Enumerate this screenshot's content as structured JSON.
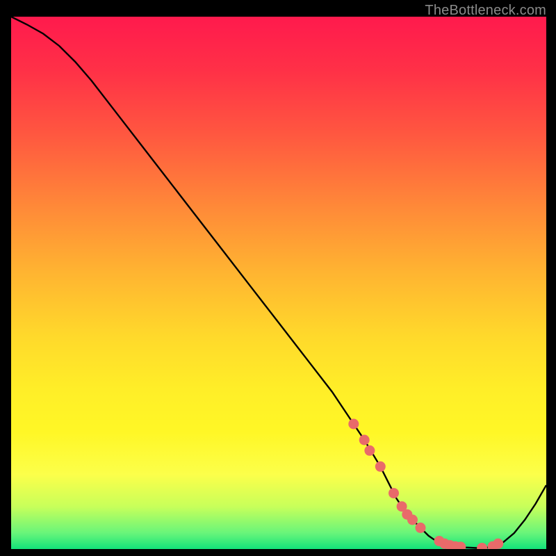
{
  "attribution": "TheBottleneck.com",
  "colors": {
    "page_bg": "#000000",
    "text": "#8a8a8a",
    "curve": "#000000",
    "marker_fill": "#e96a6a",
    "marker_stroke": "#d94f4f"
  },
  "chart_data": {
    "type": "line",
    "title": "",
    "xlabel": "",
    "ylabel": "",
    "xlim": [
      0,
      100
    ],
    "ylim": [
      0,
      100
    ],
    "series": [
      {
        "name": "curve",
        "x": [
          0,
          3,
          6,
          9,
          12,
          15,
          20,
          25,
          30,
          35,
          40,
          45,
          50,
          55,
          60,
          63,
          66,
          69,
          71,
          72,
          74,
          76,
          78,
          79,
          81,
          82,
          85,
          87,
          89,
          90,
          92,
          94,
          96,
          98,
          100
        ],
        "y": [
          100,
          98.5,
          96.8,
          94.5,
          91.5,
          88,
          81.5,
          75,
          68.5,
          62,
          55.5,
          49,
          42.5,
          36,
          29.5,
          25,
          20.5,
          15.5,
          11.5,
          9.5,
          6.5,
          4.5,
          2.5,
          1.8,
          1.0,
          0.7,
          0.3,
          0.2,
          0.3,
          0.5,
          1.3,
          3.0,
          5.5,
          8.5,
          12
        ]
      }
    ],
    "markers": {
      "name": "highlight-points",
      "x": [
        64,
        66,
        67,
        69,
        71.5,
        73,
        74,
        75,
        76.5,
        80,
        81,
        82,
        83,
        84,
        88,
        90,
        91
      ],
      "y": [
        23.5,
        20.5,
        18.5,
        15.5,
        10.5,
        8.0,
        6.5,
        5.5,
        4.0,
        1.5,
        1.0,
        0.7,
        0.5,
        0.4,
        0.2,
        0.5,
        1.0
      ]
    },
    "gradient_bands": [
      {
        "color": "#ff1a4d",
        "pct": 0
      },
      {
        "color": "#ff5740",
        "pct": 22
      },
      {
        "color": "#ffb431",
        "pct": 48
      },
      {
        "color": "#ffee28",
        "pct": 70
      },
      {
        "color": "#fcff4a",
        "pct": 86
      },
      {
        "color": "#68f57a",
        "pct": 97
      },
      {
        "color": "#12e27a",
        "pct": 100
      }
    ]
  }
}
